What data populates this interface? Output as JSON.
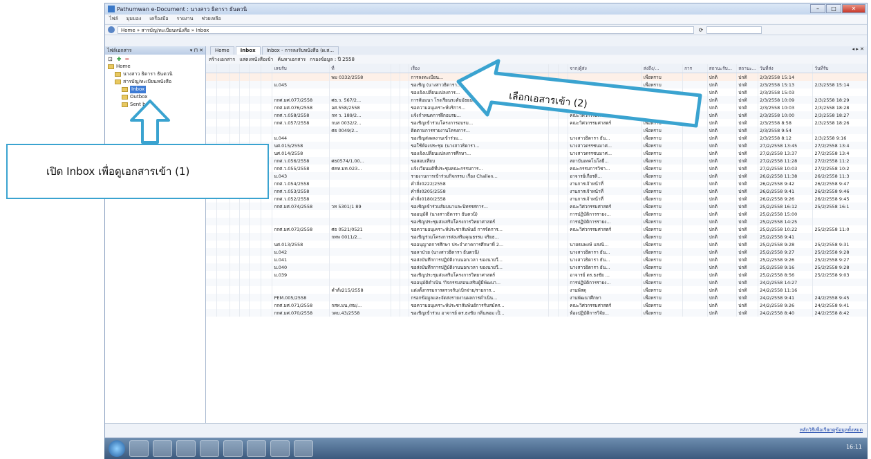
{
  "window": {
    "title": "Pathumwan e-Document : นางสาว ธิดารา ธันตวนิ",
    "menu": [
      "ไฟล์",
      "มุมมอง",
      "เครื่องมือ",
      "รายงาน",
      "ช่วยเหลือ"
    ],
    "address": "Home » สารบัญ/ทะเบียนหนังสือ » Inbox",
    "search_placeholder": "",
    "refresh_glyph": "⟳"
  },
  "sidebar": {
    "title": "ไฟล์เอกสาร",
    "pin_glyphs": "▾ ⊓ ✕",
    "tools": [
      "⊡",
      "✚",
      "━"
    ],
    "tree": [
      {
        "label": "Home",
        "indent": 0,
        "selected": false
      },
      {
        "label": "นางสาว ธิดารา ธันตวนิ",
        "indent": 1,
        "selected": false
      },
      {
        "label": "สารบัญ/ทะเบียนหนังสือ",
        "indent": 1,
        "selected": false
      },
      {
        "label": "Inbox",
        "indent": 2,
        "selected": true
      },
      {
        "label": "Outbox",
        "indent": 2,
        "selected": false
      },
      {
        "label": "Sent box",
        "indent": 2,
        "selected": false
      }
    ]
  },
  "tabs": [
    {
      "label": "Home",
      "active": false
    },
    {
      "label": "Inbox",
      "active": true
    },
    {
      "label": "Inbox - การลงรับหนังสือ (ผ.ส...",
      "active": false
    }
  ],
  "tab_nav": "◂ ▸ ✕",
  "toolbar": {
    "items": [
      "สร้างเอกสาร",
      "แสดงหนังสือเข้า",
      "ค้นหาเอกสาร",
      "กรองข้อมูล : ปี 2558"
    ]
  },
  "table": {
    "headers": [
      "",
      "",
      "",
      "",
      "",
      "",
      "เลขรับ",
      "ที่",
      "",
      "",
      "เรื่อง",
      "",
      "",
      "จาก/ผู้ส่ง",
      "ส่งถึง/...",
      "การ",
      "สถานะรับ...",
      "สถานะ...",
      "วันที่ส่ง",
      "วันที่รับ"
    ],
    "rows": [
      [
        "",
        "",
        "",
        "",
        "",
        "",
        "",
        "พม 0332/2558",
        "",
        "",
        "การลงทะเบียน...",
        "",
        "",
        "",
        "เพื่อทราบ",
        "",
        "ปกติ",
        "ปกติ",
        "2/3/2558 15:14",
        ""
      ],
      [
        "",
        "",
        "",
        "",
        "",
        "",
        "ม.045",
        "",
        "",
        "",
        "ขอเชิญ (นางสาวธิดารา...",
        "",
        "",
        "",
        "เพื่อทราบ",
        "",
        "ปกติ",
        "ปกติ",
        "2/3/2558 15:13",
        "2/3/2558 15:14"
      ],
      [
        "",
        "",
        "",
        "",
        "",
        "",
        "",
        "",
        "",
        "",
        "ขอแจ้งเปลี่ยนแปลงการ...",
        "",
        "",
        "",
        "เพื่อทราบ",
        "",
        "ปกติ",
        "ปกติ",
        "2/3/2558 15:03",
        ""
      ],
      [
        "",
        "",
        "",
        "",
        "",
        "",
        "กกศ.มศ.077/2558",
        "ศธ.ว. 567/2...",
        "",
        "",
        "การสัมมนา โรงเรียนระดับมัธยมศึกษาตอนปลาย...",
        "",
        "",
        "คณะวิศวกรรมศาสตร์",
        "เพื่อทราบ",
        "",
        "ปกติ",
        "ปกติ",
        "2/3/2558 10:09",
        "2/3/2558 18:29"
      ],
      [
        "",
        "",
        "",
        "",
        "",
        "",
        "กกศ.มศ.076/2558",
        "อศ.558/2558",
        "",
        "",
        "ขอความอนุเคราะห์บริการ...",
        "",
        "",
        "คณะวิศวกรรมศาสตร์",
        "เพื่อทราบ",
        "",
        "ปกติ",
        "ปกติ",
        "2/3/2558 10:03",
        "2/3/2558 18:28"
      ],
      [
        "",
        "",
        "",
        "",
        "",
        "",
        "กกศ.ว.058/2558",
        "กท ว. 189/2...",
        "",
        "",
        "แจ้งกำหนดการฝึกอบรม...",
        "",
        "",
        "คณะวิศวกรรมศาสตร์",
        "เพื่อทราบ",
        "",
        "ปกติ",
        "ปกติ",
        "2/3/2558 10:00",
        "2/3/2558 18:27"
      ],
      [
        "",
        "",
        "",
        "",
        "",
        "",
        "กกศ.ว.057/2558",
        "กบส 0032/2...",
        "",
        "",
        "ขอเชิญเข้าร่วมโครงการอบรม...",
        "",
        "",
        "คณะวิศวกรรมศาสตร์",
        "เพื่อทราบ",
        "",
        "ปกติ",
        "ปกติ",
        "2/3/2558 8:58",
        "2/3/2558 18:26"
      ],
      [
        "",
        "",
        "",
        "",
        "",
        "",
        "",
        "ศธ 0049/2...",
        "",
        "",
        "ติดตามการรายงานโครงการ...",
        "",
        "",
        "",
        "เพื่อทราบ",
        "",
        "ปกติ",
        "ปกติ",
        "2/3/2558 9:54",
        ""
      ],
      [
        "",
        "",
        "",
        "",
        "",
        "",
        "ม.044",
        "",
        "",
        "",
        "ขอเชิญส่งผลงานเข้าร่วม...",
        "",
        "",
        "นางสาวธิดารา ธัน...",
        "เพื่อทราบ",
        "",
        "ปกติ",
        "ปกติ",
        "2/3/2558 8:12",
        "2/3/2558 9:16"
      ],
      [
        "",
        "",
        "",
        "",
        "",
        "",
        "นศ.015/2558",
        "",
        "",
        "",
        "ขอใช้ห้องประชุม (นางสาวธิดารา...",
        "",
        "",
        "นางสาวดรรชนมาศ...",
        "เพื่อทราบ",
        "",
        "ปกติ",
        "ปกติ",
        "27/2/2558 13:45",
        "27/2/2558 13:4"
      ],
      [
        "",
        "",
        "",
        "",
        "",
        "",
        "นศ.014/2558",
        "",
        "",
        "",
        "ขอแจ้งเปลี่ยนแปลงการศึกษา...",
        "",
        "",
        "นางสาวดรรชนมาศ...",
        "เพื่อทราบ",
        "",
        "ปกติ",
        "ปกติ",
        "27/2/2558 13:37",
        "27/2/2558 13:4"
      ],
      [
        "",
        "",
        "",
        "",
        "",
        "",
        "กกศ.ว.056/2558",
        "ศธ0574/1.00...",
        "",
        "",
        "ขอสอบเทียบ",
        "",
        "",
        "สถาบันเทคโนโลยี...",
        "เพื่อทราบ",
        "",
        "ปกติ",
        "ปกติ",
        "27/2/2558 11:28",
        "27/2/2558 11:2"
      ],
      [
        "",
        "",
        "",
        "",
        "",
        "",
        "กกศ.ว.055/2558",
        "ศคท.มท.023...",
        "",
        "",
        "แจ้งเวียนมติที่ประชุมคณะกรรมการ...",
        "",
        "",
        "คณะกรรมการวิชา...",
        "เพื่อทราบ",
        "",
        "ปกติ",
        "ปกติ",
        "27/2/2558 10:03",
        "27/2/2558 10:2"
      ],
      [
        "",
        "",
        "",
        "",
        "",
        "",
        "ม.043",
        "",
        "",
        "",
        "รายงานการเข้าร่วมกิจกรรม เรื่อง Challen...",
        "",
        "",
        "อาจารย์เกียรติ...",
        "เพื่อทราบ",
        "",
        "ปกติ",
        "ปกติ",
        "26/2/2558 11:38",
        "26/2/2558 11:3"
      ],
      [
        "",
        "",
        "",
        "",
        "",
        "",
        "กกศ.ว.054/2558",
        "",
        "",
        "",
        "คำสั่ง0222/2558",
        "",
        "",
        "งานการเจ้าหน้าที่",
        "เพื่อทราบ",
        "",
        "ปกติ",
        "ปกติ",
        "26/2/2558 9:42",
        "26/2/2558 9:47"
      ],
      [
        "",
        "",
        "",
        "",
        "",
        "",
        "กกศ.ว.053/2558",
        "",
        "",
        "",
        "คำสั่ง0205/2558",
        "",
        "",
        "งานการเจ้าหน้าที่",
        "เพื่อทราบ",
        "",
        "ปกติ",
        "ปกติ",
        "26/2/2558 9:41",
        "26/2/2558 9:46"
      ],
      [
        "",
        "",
        "",
        "",
        "",
        "",
        "กกศ.ว.052/2558",
        "",
        "",
        "",
        "คำสั่ง0180/2558",
        "",
        "",
        "งานการเจ้าหน้าที่",
        "เพื่อทราบ",
        "",
        "ปกติ",
        "ปกติ",
        "26/2/2558 9:26",
        "26/2/2558 9:45"
      ],
      [
        "",
        "",
        "",
        "",
        "",
        "",
        "กกศ.มศ.074/2558",
        "วท 5301/1 89",
        "",
        "",
        "ขอเชิญเข้าร่วมสัมมนาและนิทรรศการ...",
        "",
        "",
        "คณะวิศวกรรมศาสตร์",
        "เพื่อทราบ",
        "",
        "ปกติ",
        "ปกติ",
        "25/2/2558 16:12",
        "25/2/2558 16:1"
      ],
      [
        "",
        "",
        "",
        "",
        "",
        "",
        "",
        "",
        "",
        "",
        "ขออนุมัติ (นางสาวธิดารา ธันตวนิ)",
        "",
        "",
        "การปฏิบัติการรายง...",
        "เพื่อทราบ",
        "",
        "ปกติ",
        "ปกติ",
        "25/2/2558 15:00",
        ""
      ],
      [
        "",
        "",
        "",
        "",
        "",
        "",
        "",
        "",
        "",
        "",
        "ขอเชิญประชุมส่งเสริมโครงการวิทยาศาสตร์",
        "",
        "",
        "การปฏิบัติการรายง...",
        "เพื่อทราบ",
        "",
        "ปกติ",
        "ปกติ",
        "25/2/2558 14:25",
        ""
      ],
      [
        "",
        "",
        "",
        "",
        "",
        "",
        "กกศ.มศ.073/2558",
        "ศธ 0521/0521",
        "",
        "",
        "ขอความอนุเคราะห์ประชาสัมพันธ์ การจัดการ...",
        "",
        "",
        "คณะวิศวกรรมศาสตร์",
        "เพื่อทราบ",
        "",
        "ปกติ",
        "ปกติ",
        "25/2/2558 10:22",
        "25/2/2558 11:0"
      ],
      [
        "",
        "",
        "",
        "",
        "",
        "",
        "",
        "กทพ 0011/2...",
        "",
        "",
        "ขอเชิญร่วมโครงการส่งเสริมคุณธรรม จริยธ...",
        "",
        "",
        "",
        "เพื่อทราบ",
        "",
        "ปกติ",
        "ปกติ",
        "25/2/2558 9:41",
        ""
      ],
      [
        "",
        "",
        "",
        "",
        "",
        "",
        "นศ.013/2558",
        "",
        "",
        "",
        "ขออนุญาตการศึกษา ประจำภาคการศึกษาที่ 2...",
        "",
        "",
        "นายธนพงษ์ แสงนิ...",
        "เพื่อทราบ",
        "",
        "ปกติ",
        "ปกติ",
        "25/2/2558 9:28",
        "25/2/2558 9:31"
      ],
      [
        "",
        "",
        "",
        "",
        "",
        "",
        "ม.042",
        "",
        "",
        "",
        "ขอลาป่วย (นางสาวธิดารา ธันตวนิ)",
        "",
        "",
        "นางสาวธิดารา ธัน...",
        "เพื่อทราบ",
        "",
        "ปกติ",
        "ปกติ",
        "25/2/2558 9:27",
        "25/2/2558 9:28"
      ],
      [
        "",
        "",
        "",
        "",
        "",
        "",
        "ม.041",
        "",
        "",
        "",
        "ขอส่งบันทึกการปฏิบัติงานนอกเวลา ของนายวี...",
        "",
        "",
        "นางสาวธิดารา ธัน...",
        "เพื่อทราบ",
        "",
        "ปกติ",
        "ปกติ",
        "25/2/2558 9:26",
        "25/2/2558 9:27"
      ],
      [
        "",
        "",
        "",
        "",
        "",
        "",
        "ม.040",
        "",
        "",
        "",
        "ขอส่งบันทึกการปฏิบัติงานนอกเวลา ของนายวี...",
        "",
        "",
        "นางสาวธิดารา ธัน...",
        "เพื่อทราบ",
        "",
        "ปกติ",
        "ปกติ",
        "25/2/2558 9:16",
        "25/2/2558 9:28"
      ],
      [
        "",
        "",
        "",
        "",
        "",
        "",
        "ม.039",
        "",
        "",
        "",
        "ขอเชิญประชุมส่งเสริมโครงการวิทยาศาสตร์",
        "",
        "",
        "อาจารย์ ดร.ธงชัย ...",
        "เพื่อทราบ",
        "",
        "ปกติ",
        "ปกติ",
        "25/2/2558 8:56",
        "25/2/2558 9:03"
      ],
      [
        "",
        "",
        "",
        "",
        "",
        "",
        "",
        "",
        "",
        "",
        "ขออนุมัติดำเนิน 'กิจกรรมสอนเสริมผู้มีพัฒนา...",
        "",
        "",
        "การปฏิบัติการรายง...",
        "เพื่อทราบ",
        "",
        "ปกติ",
        "ปกติ",
        "24/2/2558 14:27",
        ""
      ],
      [
        "",
        "",
        "",
        "",
        "",
        "",
        "",
        "คำสั่ง215/2558",
        "",
        "",
        "แต่งตั้งกรรมการตรวจรับ/เบิกจ่าย/รายการ...",
        "",
        "",
        "งานพัสดุ",
        "เพื่อทราบ",
        "",
        "ปกติ",
        "ปกติ",
        "24/2/2558 11:16",
        ""
      ],
      [
        "",
        "",
        "",
        "",
        "",
        "",
        "PEM.005/2558",
        "",
        "",
        "",
        "กรอกข้อมูลและจัดส่งรายงานผลการดำเนิน...",
        "",
        "",
        "งานพัฒนาศึกษา",
        "เพื่อทราบ",
        "",
        "ปกติ",
        "ปกติ",
        "24/2/2558 9:41",
        "24/2/2558 9:45"
      ],
      [
        "",
        "",
        "",
        "",
        "",
        "",
        "กกศ.มศ.071/2558",
        "กสท.มน./สม/...",
        "",
        "",
        "ขอความอนุเคราะห์ประชาสัมพันธ์การรับสมัคร...",
        "",
        "",
        "คณะวิศวกรรมศาสตร์",
        "เพื่อทราบ",
        "",
        "ปกติ",
        "ปกติ",
        "24/2/2558 9:26",
        "24/2/2558 9:41"
      ],
      [
        "",
        "",
        "",
        "",
        "",
        "",
        "กกศ.มศ.070/2558",
        "วดบ.43/2558",
        "",
        "",
        "ขอเชิญเข้าร่วม อาจารย์ ดร.ธงชัย กลิ่นหอม เป็...",
        "",
        "",
        "ห้องปฏิบัติการวิจัย...",
        "เพื่อทราบ",
        "",
        "ปกติ",
        "ปกติ",
        "24/2/2558 8:40",
        "24/2/2558 8:42"
      ]
    ]
  },
  "status_link": "หลักวิธีเพื่อเรียกดูข้อมูลทั้งหมด",
  "clock": "16:11",
  "annotations": {
    "callout1": "เปิด Inbox เพื่อดูเอกสารเข้า (1)",
    "callout2": "เลือกเอสารเข้า (2)",
    "arrow_color": "#3aa3d0"
  }
}
